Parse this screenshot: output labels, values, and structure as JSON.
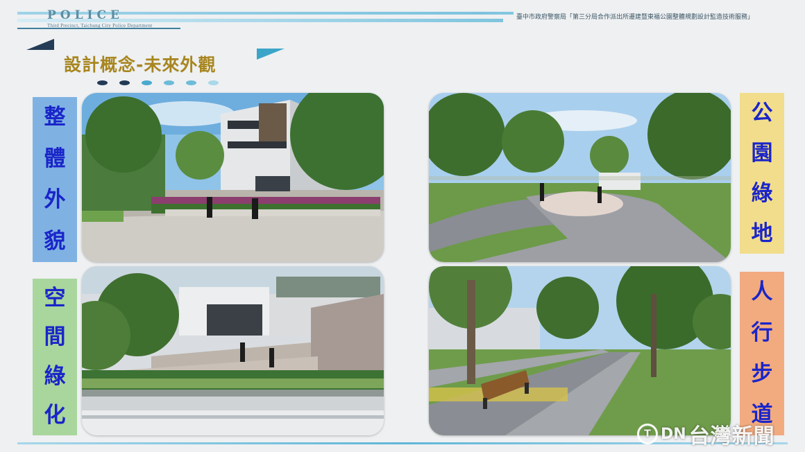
{
  "header": {
    "logo_text": "POLICE",
    "logo_subtext": "Third Precinct, Taichung City Police Department",
    "caption": "臺中市政府警察局「第三分局合作派出所遷建暨東福公園整體規劃設計監造技術服務」"
  },
  "slide": {
    "title": "設計概念-未來外觀",
    "dot_colors": [
      "#233a55",
      "#233a55",
      "#4aa9cf",
      "#6dbbd9",
      "#6dbbd9",
      "#a8d8ea"
    ]
  },
  "labels": {
    "overall_exterior": {
      "chars": [
        "整",
        "體",
        "外",
        "貌"
      ],
      "bg": "#7fb2e3"
    },
    "space_greening": {
      "chars": [
        "空",
        "間",
        "綠",
        "化"
      ],
      "bg": "#a8d69c"
    },
    "park_greenland": {
      "chars": [
        "公",
        "園",
        "綠",
        "地"
      ],
      "bg": "#f2dd8c"
    },
    "sidewalk": {
      "chars": [
        "人",
        "行",
        "步",
        "道"
      ],
      "bg": "#f2ab7f"
    }
  },
  "images": {
    "building_exterior": "building-render",
    "rooftop_garden": "rooftop-render",
    "park_plaza": "park-render",
    "walkway": "walkway-render"
  },
  "watermark": {
    "circle": "T",
    "dn": "DN",
    "text": "台灣新聞"
  }
}
